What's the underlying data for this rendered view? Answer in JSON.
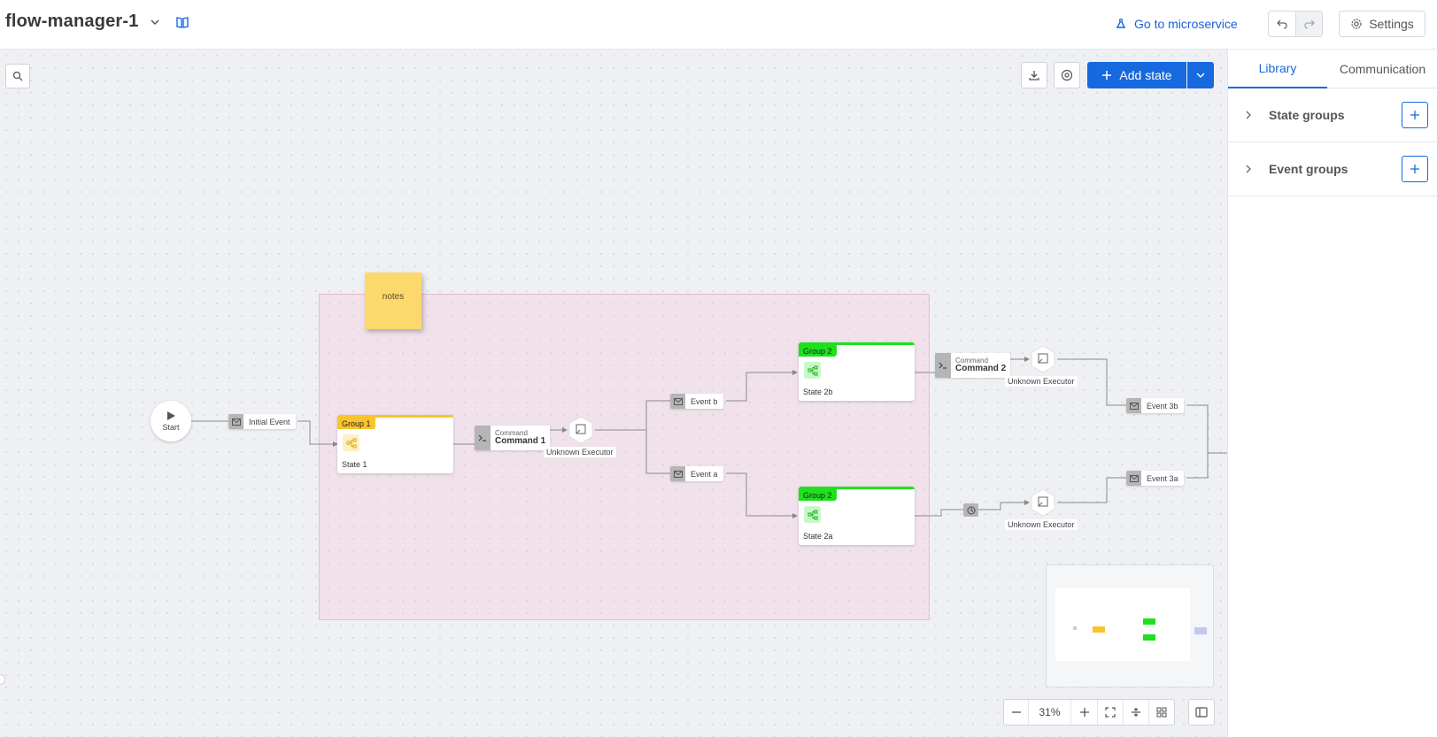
{
  "header": {
    "flow_name": "flow-manager-1",
    "goto_label": "Go to microservice",
    "settings_label": "Settings"
  },
  "toolbar": {
    "add_state_label": "Add state"
  },
  "canvas": {
    "note_text": "notes",
    "start_label": "Start",
    "events": {
      "initial": "Initial Event",
      "event_b": "Event b",
      "event_a": "Event a",
      "event_3b": "Event 3b",
      "event_3a": "Event 3a"
    },
    "commands": {
      "kind": "Command",
      "command_1": "Command 1",
      "command_2": "Command 2"
    },
    "executor_label": "Unknown Executor",
    "states": {
      "state_1": {
        "group": "Group 1",
        "name": "State 1",
        "color": "#f7c52b"
      },
      "state_2b": {
        "group": "Group 2",
        "name": "State 2b",
        "color": "#1ee01e"
      },
      "state_2a": {
        "group": "Group 2",
        "name": "State 2a",
        "color": "#1ee01e"
      }
    }
  },
  "zoom": {
    "level": "31%"
  },
  "sidepanel": {
    "tabs": [
      "Library",
      "Communication"
    ],
    "active_tab": "Library",
    "state_groups_label": "State groups",
    "event_groups_label": "Event groups"
  },
  "colors": {
    "accent": "#1769e0",
    "group1": "#f7c52b",
    "group2": "#1ee01e",
    "note": "#fdd96d"
  }
}
